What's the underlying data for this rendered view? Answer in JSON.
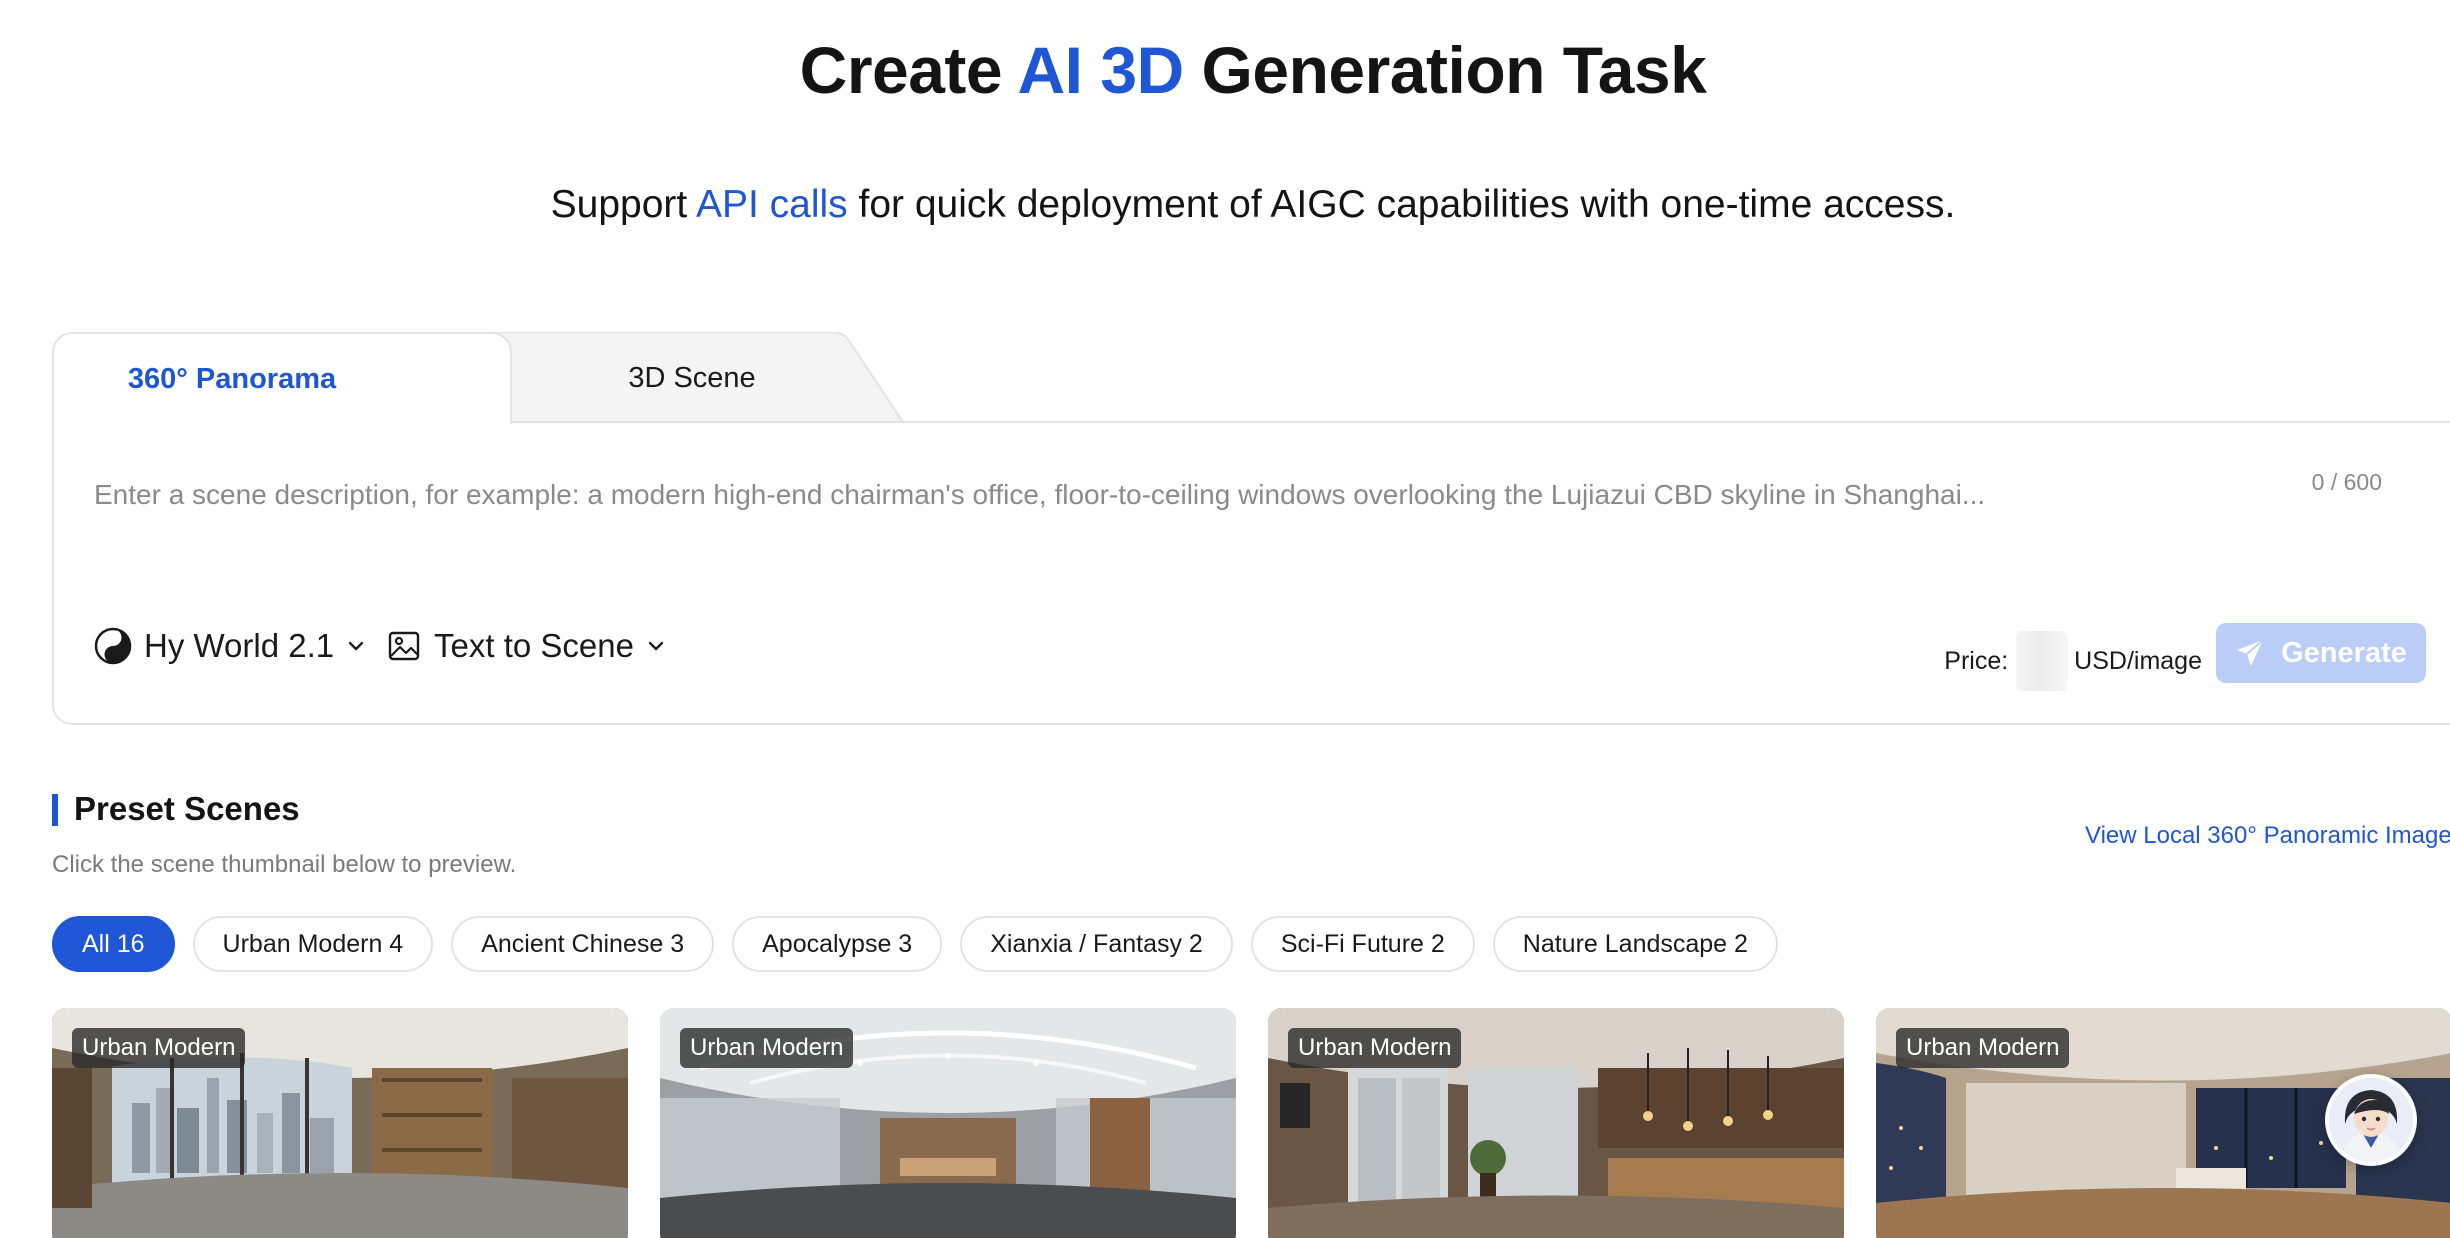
{
  "hero": {
    "title_pre": "Create ",
    "title_accent": "AI 3D",
    "title_post": " Generation Task",
    "sub_pre": "Support ",
    "sub_accent": "API calls",
    "sub_post": " for quick deployment of AIGC capabilities with one-time access."
  },
  "tabs": [
    {
      "label": "360° Panorama",
      "active": true
    },
    {
      "label": "3D Scene",
      "active": false
    }
  ],
  "composer": {
    "placeholder": "Enter a scene description, for example: a modern high-end chairman's office, floor-to-ceiling windows overlooking the Lujiazui CBD skyline in Shanghai...",
    "value": "",
    "char_count": "0 / 600",
    "model": "Hy World 2.1",
    "mode": "Text to Scene",
    "price_label": "Price:",
    "price_unit": "USD/image",
    "generate_label": "Generate"
  },
  "preset": {
    "title": "Preset Scenes",
    "hint": "Click the scene thumbnail below to preview.",
    "view_local": "View Local 360° Panoramic Image",
    "filters": [
      {
        "label": "All 16",
        "active": true
      },
      {
        "label": "Urban Modern 4",
        "active": false
      },
      {
        "label": "Ancient Chinese 3",
        "active": false
      },
      {
        "label": "Apocalypse 3",
        "active": false
      },
      {
        "label": "Xianxia / Fantasy 2",
        "active": false
      },
      {
        "label": "Sci-Fi Future 2",
        "active": false
      },
      {
        "label": "Nature Landscape 2",
        "active": false
      }
    ],
    "cards": [
      {
        "tag": "Urban Modern"
      },
      {
        "tag": "Urban Modern"
      },
      {
        "tag": "Urban Modern"
      },
      {
        "tag": "Urban Modern"
      }
    ]
  },
  "colors": {
    "accent": "#1f56d6",
    "generate_disabled": "#b9cdf7",
    "border": "#e3e3e3"
  }
}
